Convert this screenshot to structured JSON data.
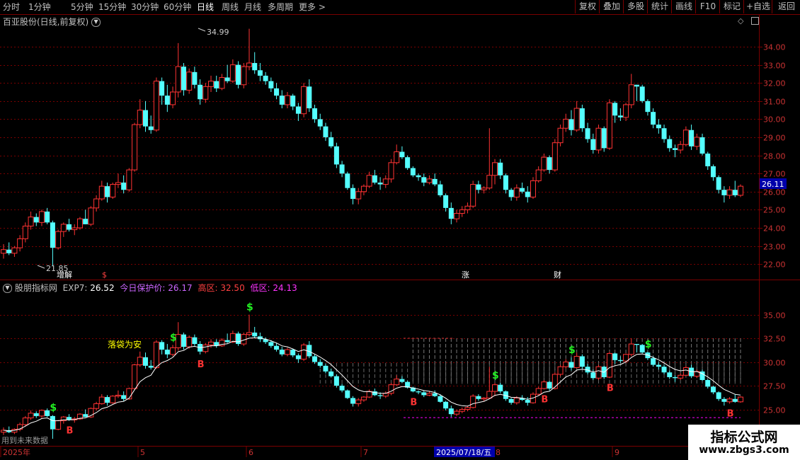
{
  "toolbar": {
    "tabs": [
      {
        "label": "分时",
        "x": 4,
        "active": false
      },
      {
        "label": "1分钟",
        "x": 40,
        "active": false
      },
      {
        "label": "5分钟",
        "x": 100,
        "active": false
      },
      {
        "label": "15分钟",
        "x": 139,
        "active": false
      },
      {
        "label": "30分钟",
        "x": 185,
        "active": false
      },
      {
        "label": "60分钟",
        "x": 231,
        "active": false
      },
      {
        "label": "日线",
        "x": 278,
        "active": true
      },
      {
        "label": "周线",
        "x": 313,
        "active": false
      },
      {
        "label": "月线",
        "x": 345,
        "active": false
      },
      {
        "label": "多周期",
        "x": 378,
        "active": false
      },
      {
        "label": "更多 >",
        "x": 422,
        "active": false
      }
    ],
    "buttons": [
      {
        "label": "复权",
        "x": 812,
        "w": 34
      },
      {
        "label": "叠加",
        "x": 846,
        "w": 34
      },
      {
        "label": "多股",
        "x": 880,
        "w": 34
      },
      {
        "label": "统计",
        "x": 914,
        "w": 34
      },
      {
        "label": "画线",
        "x": 948,
        "w": 34
      },
      {
        "label": "F10",
        "x": 982,
        "w": 34
      },
      {
        "label": "标记",
        "x": 1016,
        "w": 34
      },
      {
        "label": "+自选",
        "x": 1050,
        "w": 40
      },
      {
        "label": "返回",
        "x": 1090,
        "w": 40
      }
    ]
  },
  "main_panel": {
    "title": "百亚股份(日线,前复权)",
    "y_ticks": [
      "34.00",
      "33.00",
      "32.00",
      "31.00",
      "30.00",
      "29.00",
      "28.00",
      "27.00",
      "26.00",
      "25.00",
      "24.00",
      "23.00",
      "22.00"
    ],
    "current_price": "26.11",
    "max_label": "34.99",
    "min_label": "21.85",
    "event_markers": [
      {
        "text": "增解",
        "color": "#ffffff"
      },
      {
        "text": "$",
        "color": "#ff4040"
      },
      {
        "text": "涨",
        "color": "#ffffff"
      },
      {
        "text": "财",
        "color": "#ffffff"
      }
    ]
  },
  "indicator_panel": {
    "title": "股朋指标网",
    "exp7_label": "EXP7:",
    "exp7_value": "26.52",
    "protect_label": "今日保护价:",
    "protect_value": "26.17",
    "high_label": "高区:",
    "high_value": "32.50",
    "low_label": "低区:",
    "low_value": "24.13",
    "y_ticks": [
      "35.00",
      "32.50",
      "30.00",
      "27.50",
      "25.00"
    ],
    "annotation": "落袋为安",
    "footer_note": "用到未来数据",
    "signals": {
      "sell": "$",
      "buy": "B"
    }
  },
  "date_axis": {
    "labels": [
      {
        "text": "2025年",
        "x": 4
      },
      {
        "text": "5",
        "x": 198
      },
      {
        "text": "6",
        "x": 351
      },
      {
        "text": "7",
        "x": 513
      },
      {
        "text": "8",
        "x": 700
      },
      {
        "text": "9",
        "x": 868
      }
    ],
    "cursor_date": "2025/07/18/五"
  },
  "colors": {
    "up": "#ff3333",
    "down": "#54ffff",
    "grid": "#7a0000",
    "ma": "#ffffff",
    "accent": "#ff00ff"
  },
  "watermark": {
    "line1": "指标公式网",
    "line2": "www.zbgs3.com"
  },
  "chart_data": {
    "type": "candlestick",
    "x_range": [
      "2025-03",
      "2025-09"
    ],
    "y_range": [
      21.5,
      35.2
    ],
    "candles": [
      [
        22.6,
        23.1,
        22.3,
        22.8
      ],
      [
        22.8,
        23.2,
        22.5,
        22.6
      ],
      [
        22.6,
        23.0,
        22.4,
        22.9
      ],
      [
        22.9,
        23.6,
        22.7,
        23.4
      ],
      [
        23.4,
        24.3,
        23.2,
        24.1
      ],
      [
        24.1,
        24.9,
        23.9,
        24.6
      ],
      [
        24.6,
        24.8,
        24.1,
        24.3
      ],
      [
        24.3,
        25.0,
        24.1,
        24.9
      ],
      [
        24.9,
        25.1,
        24.2,
        24.3
      ],
      [
        24.3,
        24.4,
        21.9,
        22.9
      ],
      [
        22.9,
        23.9,
        22.8,
        23.8
      ],
      [
        23.8,
        24.3,
        23.5,
        24.2
      ],
      [
        24.2,
        24.5,
        23.8,
        23.9
      ],
      [
        23.9,
        24.2,
        23.6,
        24.0
      ],
      [
        24.0,
        24.6,
        23.9,
        24.5
      ],
      [
        24.5,
        25.0,
        24.2,
        24.2
      ],
      [
        24.2,
        25.2,
        24.1,
        25.1
      ],
      [
        25.1,
        25.8,
        24.9,
        25.6
      ],
      [
        25.6,
        26.6,
        25.5,
        26.3
      ],
      [
        26.3,
        26.5,
        25.4,
        25.7
      ],
      [
        25.7,
        26.5,
        25.6,
        26.4
      ],
      [
        26.4,
        27.0,
        26.2,
        26.5
      ],
      [
        26.5,
        26.9,
        25.9,
        26.1
      ],
      [
        26.1,
        27.3,
        26.0,
        27.2
      ],
      [
        27.2,
        29.8,
        27.1,
        29.7
      ],
      [
        29.7,
        31.1,
        29.5,
        30.5
      ],
      [
        30.5,
        31.0,
        29.3,
        29.6
      ],
      [
        29.6,
        30.2,
        29.2,
        29.4
      ],
      [
        29.4,
        32.3,
        29.3,
        32.1
      ],
      [
        32.1,
        32.3,
        30.8,
        31.3
      ],
      [
        31.3,
        31.9,
        30.4,
        30.8
      ],
      [
        30.8,
        31.8,
        30.6,
        31.5
      ],
      [
        31.5,
        34.2,
        31.2,
        32.9
      ],
      [
        32.9,
        33.1,
        31.3,
        31.6
      ],
      [
        31.6,
        32.8,
        31.4,
        32.6
      ],
      [
        32.6,
        32.9,
        31.7,
        31.9
      ],
      [
        31.9,
        32.2,
        30.8,
        31.1
      ],
      [
        31.1,
        32.0,
        30.9,
        31.8
      ],
      [
        31.8,
        32.4,
        31.5,
        32.1
      ],
      [
        32.1,
        32.4,
        31.5,
        31.7
      ],
      [
        31.7,
        32.5,
        31.6,
        32.3
      ],
      [
        32.3,
        33.0,
        32.0,
        32.1
      ],
      [
        32.1,
        33.3,
        32.0,
        33.0
      ],
      [
        33.0,
        33.2,
        31.7,
        31.9
      ],
      [
        31.9,
        33.1,
        31.7,
        32.9
      ],
      [
        32.9,
        34.99,
        32.7,
        33.1
      ],
      [
        33.1,
        33.7,
        32.5,
        32.7
      ],
      [
        32.7,
        33.1,
        32.1,
        32.4
      ],
      [
        32.4,
        32.6,
        31.9,
        32.1
      ],
      [
        32.1,
        32.3,
        31.5,
        31.7
      ],
      [
        31.7,
        32.0,
        31.1,
        31.3
      ],
      [
        31.3,
        31.6,
        30.6,
        30.8
      ],
      [
        30.8,
        31.5,
        30.6,
        31.3
      ],
      [
        31.3,
        31.4,
        30.5,
        30.7
      ],
      [
        30.7,
        30.9,
        29.9,
        30.3
      ],
      [
        30.3,
        32.0,
        30.1,
        31.8
      ],
      [
        31.8,
        32.2,
        30.4,
        30.6
      ],
      [
        30.6,
        30.8,
        29.8,
        30.0
      ],
      [
        30.0,
        30.3,
        29.4,
        29.6
      ],
      [
        29.6,
        29.8,
        28.8,
        29.0
      ],
      [
        29.0,
        29.3,
        28.4,
        28.5
      ],
      [
        28.5,
        28.7,
        27.3,
        27.5
      ],
      [
        27.5,
        27.7,
        26.8,
        27.0
      ],
      [
        27.0,
        27.1,
        26.1,
        26.2
      ],
      [
        26.2,
        26.4,
        25.3,
        25.6
      ],
      [
        25.6,
        26.2,
        25.3,
        26.0
      ],
      [
        26.0,
        26.4,
        25.8,
        26.3
      ],
      [
        26.3,
        27.1,
        26.2,
        26.9
      ],
      [
        26.9,
        27.2,
        26.4,
        26.5
      ],
      [
        26.5,
        26.8,
        26.1,
        26.4
      ],
      [
        26.4,
        26.9,
        26.2,
        26.7
      ],
      [
        26.7,
        27.8,
        26.5,
        27.6
      ],
      [
        27.6,
        28.6,
        27.5,
        28.2
      ],
      [
        28.2,
        28.5,
        27.8,
        27.9
      ],
      [
        27.9,
        28.0,
        27.2,
        27.3
      ],
      [
        27.3,
        27.4,
        26.8,
        26.9
      ],
      [
        26.9,
        27.0,
        26.6,
        26.8
      ],
      [
        26.8,
        27.0,
        26.3,
        26.5
      ],
      [
        26.5,
        26.9,
        26.4,
        26.7
      ],
      [
        26.7,
        27.0,
        26.3,
        26.4
      ],
      [
        26.4,
        26.6,
        25.7,
        25.8
      ],
      [
        25.8,
        25.9,
        24.9,
        25.1
      ],
      [
        25.1,
        25.4,
        24.2,
        24.5
      ],
      [
        24.5,
        25.0,
        24.3,
        24.8
      ],
      [
        24.8,
        25.2,
        24.6,
        25.0
      ],
      [
        25.0,
        25.4,
        24.8,
        25.2
      ],
      [
        25.2,
        26.6,
        25.1,
        26.4
      ],
      [
        26.4,
        26.6,
        25.9,
        26.1
      ],
      [
        26.1,
        26.3,
        25.9,
        26.2
      ],
      [
        26.2,
        29.5,
        26.1,
        26.9
      ],
      [
        26.9,
        27.8,
        26.4,
        27.6
      ],
      [
        27.6,
        27.8,
        26.7,
        26.9
      ],
      [
        26.9,
        27.0,
        25.9,
        26.1
      ],
      [
        26.1,
        26.2,
        25.5,
        25.7
      ],
      [
        25.7,
        26.4,
        25.5,
        26.2
      ],
      [
        26.2,
        26.5,
        25.9,
        26.0
      ],
      [
        26.0,
        26.3,
        25.4,
        25.7
      ],
      [
        25.7,
        26.8,
        25.6,
        26.6
      ],
      [
        26.6,
        27.4,
        26.5,
        27.2
      ],
      [
        27.2,
        28.1,
        27.1,
        27.9
      ],
      [
        27.9,
        28.0,
        27.0,
        27.2
      ],
      [
        27.2,
        28.9,
        27.1,
        28.7
      ],
      [
        28.7,
        29.7,
        28.5,
        29.5
      ],
      [
        29.5,
        30.3,
        29.3,
        30.0
      ],
      [
        30.0,
        30.5,
        29.1,
        29.4
      ],
      [
        29.4,
        31.0,
        29.3,
        30.6
      ],
      [
        30.6,
        30.8,
        29.3,
        29.5
      ],
      [
        29.5,
        29.8,
        28.7,
        28.9
      ],
      [
        28.9,
        29.2,
        28.1,
        28.3
      ],
      [
        28.3,
        29.7,
        28.1,
        29.5
      ],
      [
        29.5,
        29.6,
        28.2,
        28.4
      ],
      [
        28.4,
        31.1,
        28.3,
        30.9
      ],
      [
        30.9,
        31.0,
        29.8,
        30.2
      ],
      [
        30.2,
        30.6,
        29.9,
        30.1
      ],
      [
        30.1,
        30.9,
        29.9,
        30.8
      ],
      [
        30.8,
        32.5,
        30.6,
        31.9
      ],
      [
        31.9,
        31.9,
        31.0,
        31.8
      ],
      [
        31.8,
        31.9,
        30.9,
        31.0
      ],
      [
        31.0,
        31.1,
        30.2,
        30.4
      ],
      [
        30.4,
        30.6,
        29.5,
        29.7
      ],
      [
        29.7,
        30.0,
        29.2,
        29.5
      ],
      [
        29.5,
        29.7,
        28.7,
        28.9
      ],
      [
        28.9,
        29.1,
        28.2,
        28.4
      ],
      [
        28.4,
        28.6,
        27.9,
        28.3
      ],
      [
        28.3,
        28.8,
        28.1,
        28.6
      ],
      [
        28.6,
        29.6,
        28.5,
        29.4
      ],
      [
        29.4,
        29.7,
        28.3,
        28.5
      ],
      [
        28.5,
        29.2,
        28.3,
        29.0
      ],
      [
        29.0,
        29.2,
        28.0,
        28.1
      ],
      [
        28.1,
        28.2,
        27.2,
        27.4
      ],
      [
        27.4,
        27.5,
        26.6,
        26.8
      ],
      [
        26.8,
        26.9,
        25.9,
        26.1
      ],
      [
        26.1,
        26.3,
        25.4,
        25.8
      ],
      [
        25.8,
        26.3,
        25.6,
        26.1
      ],
      [
        26.1,
        26.6,
        25.7,
        25.8
      ],
      [
        25.8,
        26.4,
        25.7,
        26.3
      ]
    ]
  }
}
